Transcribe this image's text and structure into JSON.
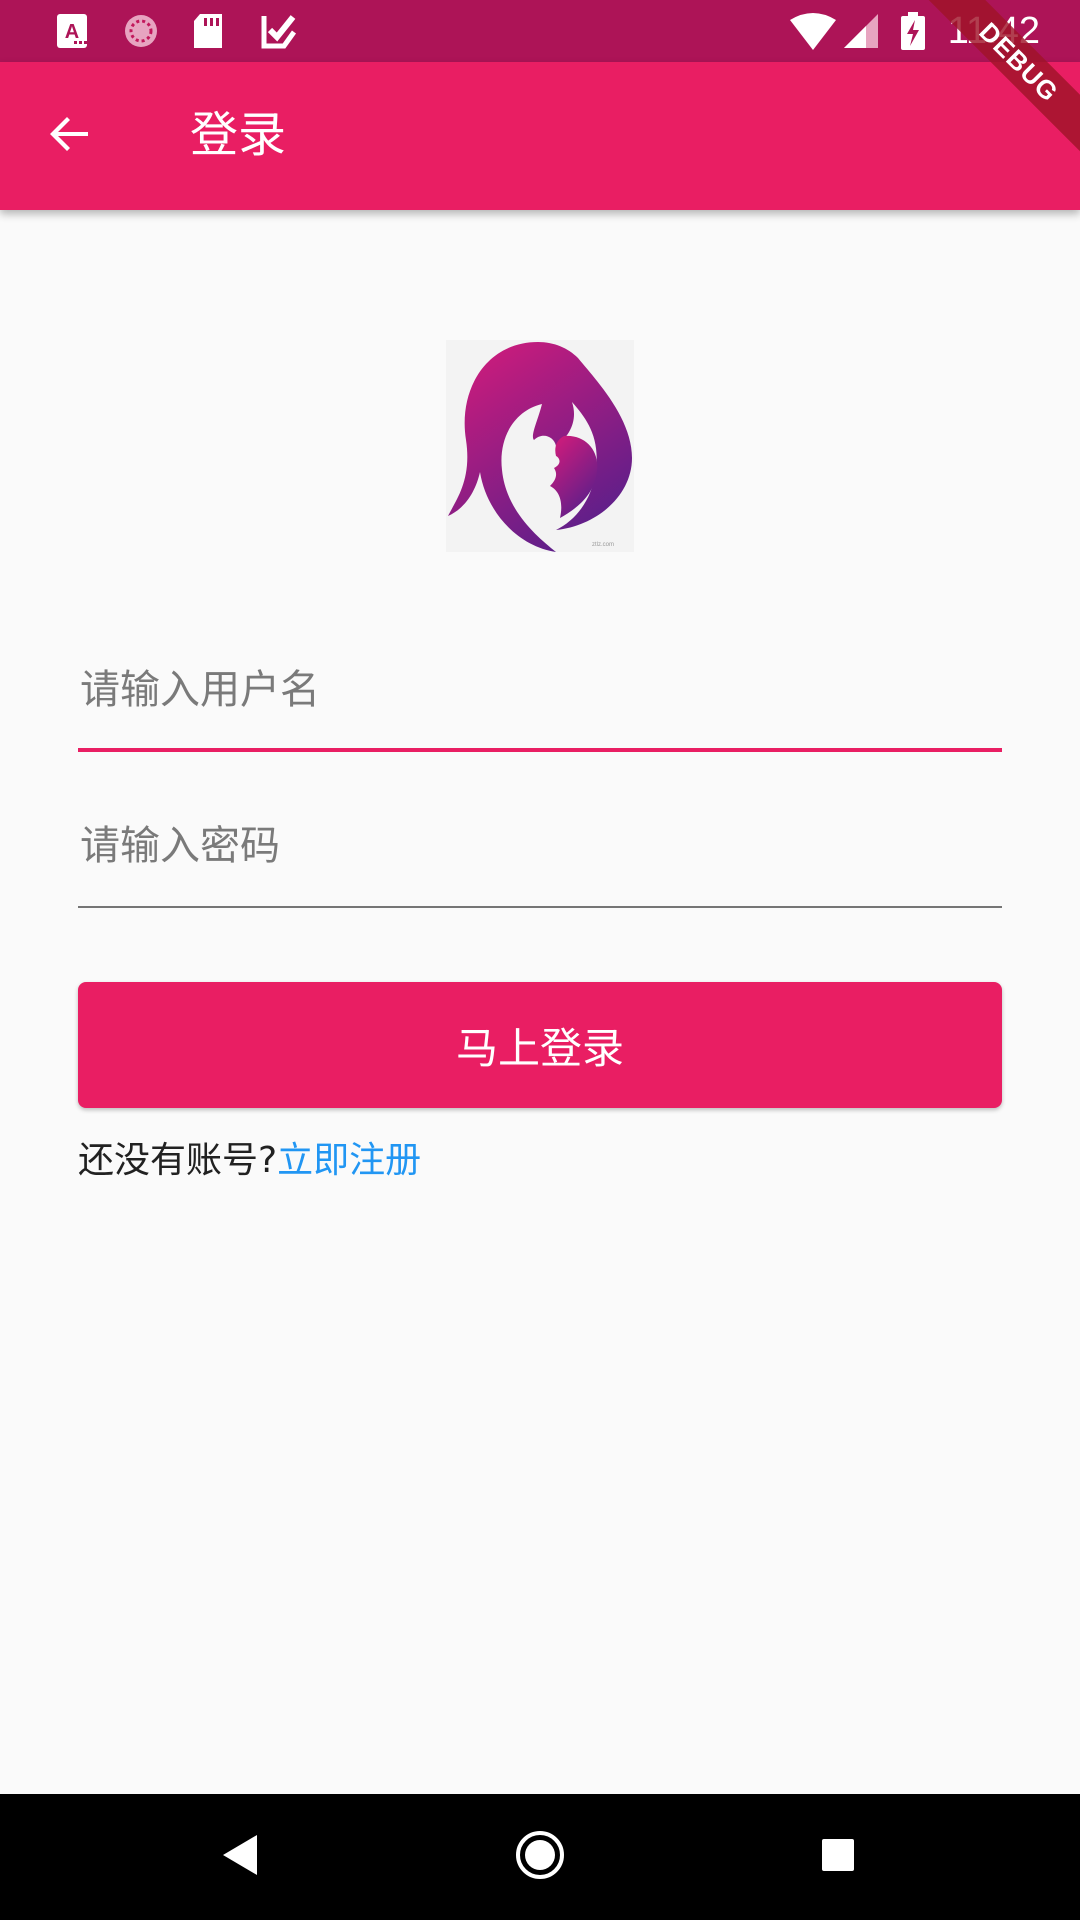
{
  "status_bar": {
    "time": "11:42",
    "icons": [
      "font-notification-icon",
      "loading-circle-icon",
      "sd-card-icon",
      "check-square-icon",
      "wifi-icon",
      "signal-icon",
      "battery-charging-icon"
    ]
  },
  "debug_banner": "DEBUG",
  "app_bar": {
    "title": "登录",
    "back_icon": "arrow-back-icon"
  },
  "logo": {
    "name": "mother-baby-logo-icon"
  },
  "form": {
    "username_placeholder": "请输入用户名",
    "password_placeholder": "请输入密码",
    "login_button": "马上登录"
  },
  "register": {
    "prompt": "还没有账号?",
    "link": "立即注册"
  },
  "colors": {
    "primary": "#e91e63",
    "primary_dark": "#ad1457",
    "link": "#2196f3",
    "background": "#fafafa"
  },
  "nav_bar": {
    "icons": [
      "back-triangle-icon",
      "home-circle-icon",
      "recents-square-icon"
    ]
  }
}
